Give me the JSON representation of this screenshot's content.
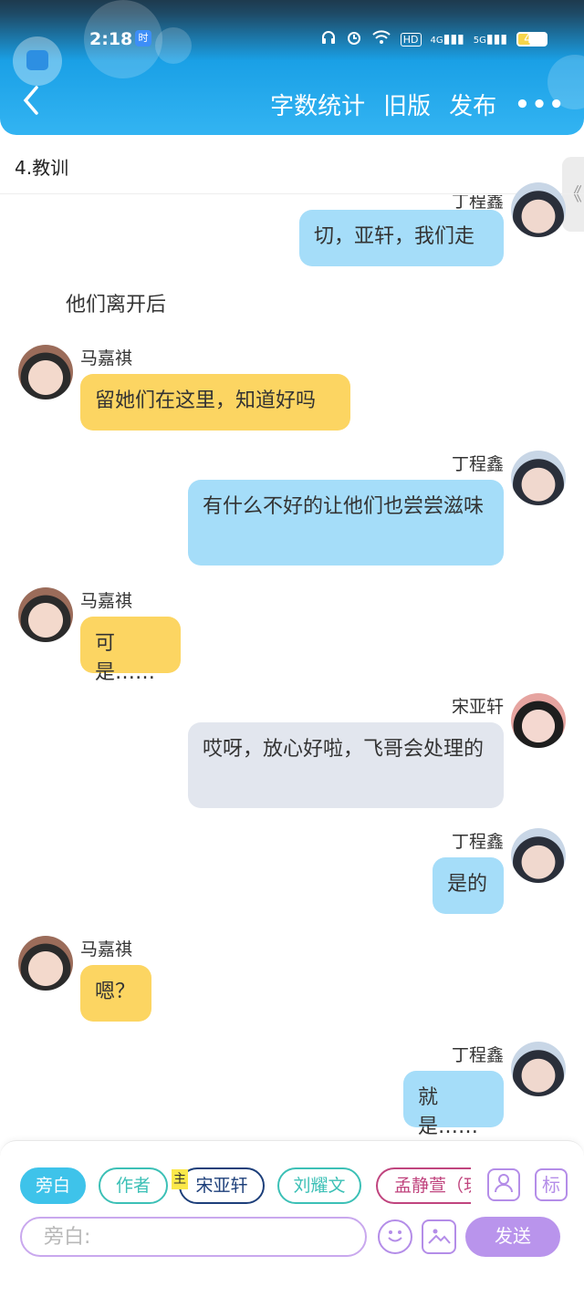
{
  "status_bar": {
    "time": "2:18",
    "time_badge": "时",
    "icons": [
      "headphones-icon",
      "alarm-icon",
      "wifi-icon",
      "hd-icon",
      "4g-signal-icon",
      "5g-signal-icon"
    ],
    "hd": "HD",
    "signal_4g": "4G",
    "signal_5g": "5G",
    "battery": "42"
  },
  "nav": {
    "back": "‹",
    "word_count": "字数统计",
    "old_version": "旧版",
    "publish": "发布",
    "more": "•••"
  },
  "chapter": {
    "title": "4.教训",
    "side_handle": "《"
  },
  "messages": {
    "partial_name": "丁程鑫",
    "m0": {
      "text": "切，亚轩，我们走"
    },
    "narration": "他们离开后",
    "m1": {
      "name": "马嘉祺",
      "text": "留她们在这里，知道好吗"
    },
    "m2": {
      "name": "丁程鑫",
      "text": "有什么不好的让他们也尝尝滋味"
    },
    "m3": {
      "name": "马嘉祺",
      "text": "可是……"
    },
    "m4": {
      "name": "宋亚轩",
      "text": "哎呀，放心好啦，飞哥会处理的"
    },
    "m5": {
      "name": "丁程鑫",
      "text": "是的"
    },
    "m6": {
      "name": "马嘉祺",
      "text": "嗯？"
    },
    "m7": {
      "name": "丁程鑫",
      "text": "就是……"
    }
  },
  "composer": {
    "roles": [
      "旁白",
      "作者",
      "宋亚轩",
      "刘耀文",
      "孟静萱（玥"
    ],
    "main_badge": "主",
    "role_colors": {
      "narration": "#3ec3ea",
      "author": "#3cc0b6",
      "songyaxuan": "#1d3f7a",
      "liuyaowen": "#3cc0b6",
      "mengjingxuan": "#c0447e"
    },
    "profile_icon": "person-icon",
    "tag_label": "标",
    "placeholder": "旁白:",
    "emoji_icon": "smile-icon",
    "image_icon": "image-icon",
    "send": "发送"
  }
}
